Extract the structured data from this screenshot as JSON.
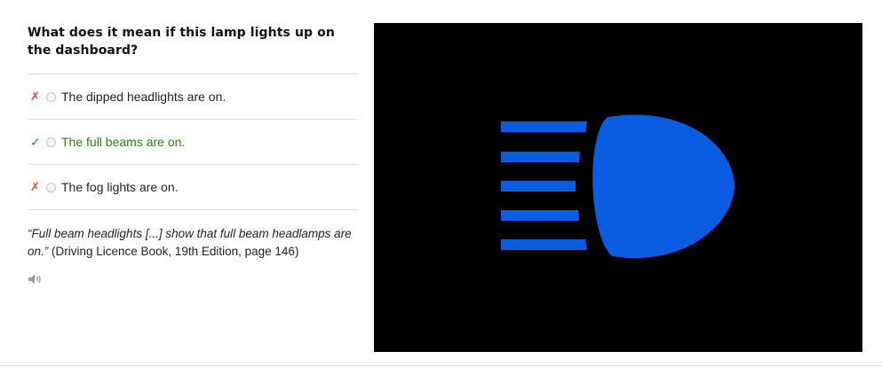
{
  "question": "What does it mean if this lamp lights up on the dashboard?",
  "answers": [
    {
      "mark": "✗",
      "status": "wrong",
      "label": "The dipped headlights are on."
    },
    {
      "mark": "✓",
      "status": "correct",
      "label": "The full beams are on."
    },
    {
      "mark": "✗",
      "status": "wrong",
      "label": "The fog lights are on."
    }
  ],
  "explanation": {
    "quote": "“Full beam headlights [...] show that full beam headlamps are on.”",
    "source": " (Driving Licence Book, 19th Edition, page 146)"
  },
  "icons": {
    "audio": "speaker-icon",
    "lamp": "full-beam-headlight-icon"
  },
  "colors": {
    "lamp_blue": "#0a5ce0",
    "correct_green": "#2f7d1a",
    "wrong_red": "#e04b4b"
  }
}
